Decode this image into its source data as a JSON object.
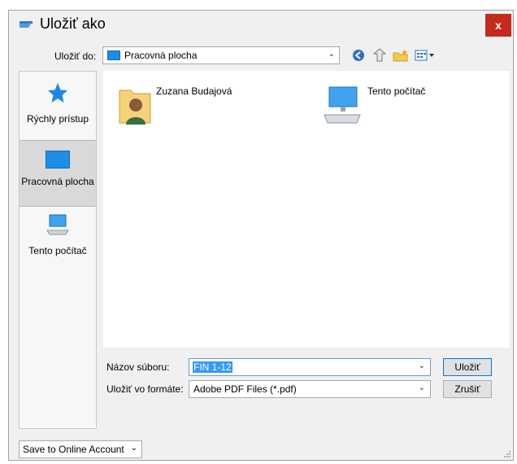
{
  "window": {
    "title": "Uložiť ako",
    "close_glyph": "x"
  },
  "toolbar": {
    "save_in_label": "Uložiť do:",
    "save_in_value": "Pracovná plocha",
    "icons": [
      "back-icon",
      "up-folder-icon",
      "new-folder-icon",
      "views-menu-icon"
    ]
  },
  "sidebar": {
    "items": [
      {
        "label": "Rýchly prístup",
        "icon": "star-icon"
      },
      {
        "label": "Pracovná plocha",
        "icon": "desktop-icon",
        "selected": true
      },
      {
        "label": "Tento počítač",
        "icon": "computer-icon"
      }
    ]
  },
  "files": [
    {
      "label": "Zuzana Budajová",
      "icon": "user-folder-icon"
    },
    {
      "label": "Tento počítač",
      "icon": "computer-icon"
    }
  ],
  "form": {
    "filename_label": "Názov súboru:",
    "filename_value": "FIN 1-12",
    "format_label": "Uložiť vo formáte:",
    "format_value": "Adobe PDF Files (*.pdf)",
    "save_button": "Uložiť",
    "cancel_button": "Zrušiť"
  },
  "footer": {
    "online_account": "Save to Online Account"
  },
  "colors": {
    "accent": "#0078d7",
    "close": "#c42b1c",
    "desktop_blue": "#1c8ee8"
  }
}
